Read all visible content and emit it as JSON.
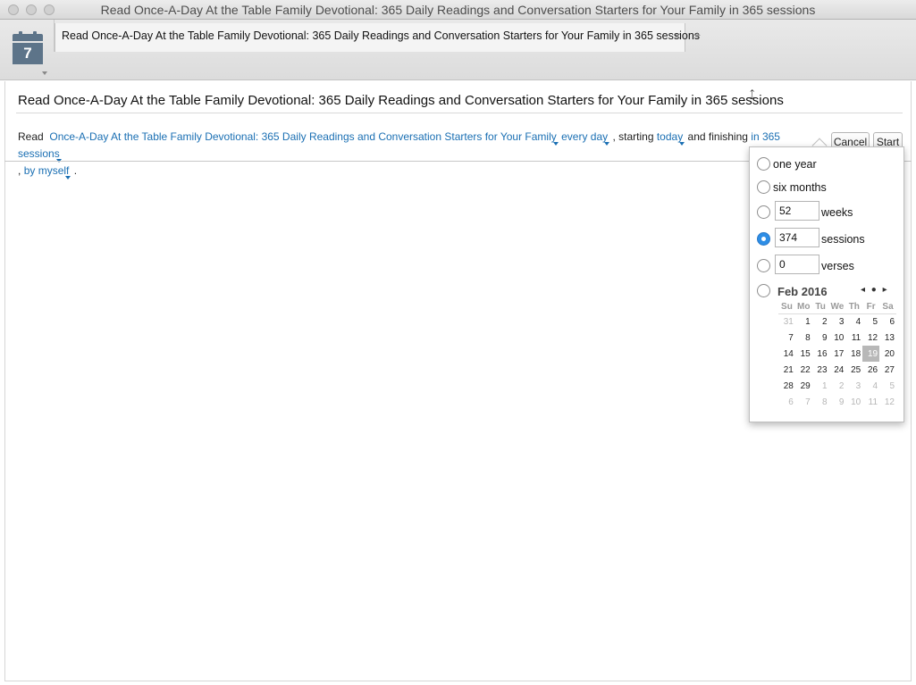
{
  "window": {
    "title": "Read Once-A-Day At the Table Family Devotional: 365 Daily Readings and Conversation Starters for Your Family in 365 sessions"
  },
  "toolbar": {
    "calendar_icon": "calendar-icon",
    "calendar_day": "7"
  },
  "tabs": [
    {
      "label": "Read Once-A-Day At the Table Family Devotional: 365 Daily Readings and Conversation Starters for Your Family in 365 sessions",
      "close": "×"
    }
  ],
  "tab_add": "+",
  "page": {
    "title": "Read Once-A-Day At the Table Family Devotional: 365 Daily Readings and Conversation Starters for Your Family in 365 sessions",
    "edit_icon": "⤢"
  },
  "sentence": {
    "read": "Read",
    "book": "Once-A-Day At the Table Family Devotional: 365 Daily Readings and Conversation Starters for Your Family",
    "frequency": "every day",
    "starting_text": ", starting",
    "start": "today",
    "finishing_text": "and finishing",
    "finish": "in 365 sessions",
    "comma": ",",
    "who": "by myself",
    "period": "."
  },
  "buttons": {
    "cancel": "Cancel",
    "start": "Start"
  },
  "popup": {
    "options": {
      "one_year": "one year",
      "six_months": "six months",
      "weeks_value": "52",
      "weeks_unit": "weeks",
      "sessions_value": "374",
      "sessions_unit": "sessions",
      "verses_value": "0",
      "verses_unit": "verses"
    },
    "selected": "sessions",
    "calendar": {
      "month": "Feb 2016",
      "nav": "◂ ● ▸",
      "weekdays": [
        "Su",
        "Mo",
        "Tu",
        "We",
        "Th",
        "Fr",
        "Sa"
      ],
      "weeks": [
        [
          "31",
          "1",
          "2",
          "3",
          "4",
          "5",
          "6"
        ],
        [
          "7",
          "8",
          "9",
          "10",
          "11",
          "12",
          "13"
        ],
        [
          "14",
          "15",
          "16",
          "17",
          "18",
          "19",
          "20"
        ],
        [
          "21",
          "22",
          "23",
          "24",
          "25",
          "26",
          "27"
        ],
        [
          "28",
          "29",
          "1",
          "2",
          "3",
          "4",
          "5"
        ],
        [
          "6",
          "7",
          "8",
          "9",
          "10",
          "11",
          "12"
        ]
      ],
      "today": "19"
    }
  }
}
